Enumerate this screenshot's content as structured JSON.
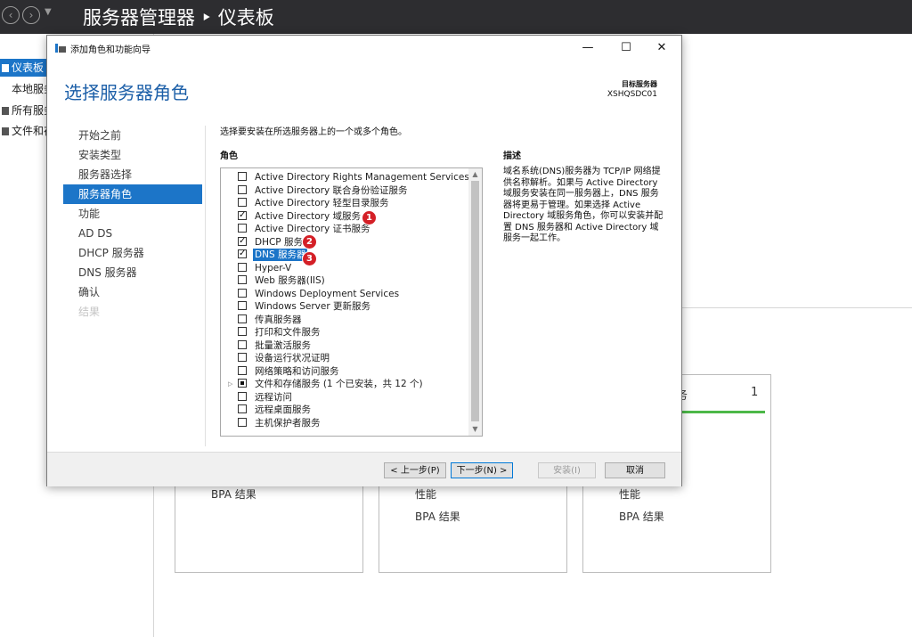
{
  "server_manager": {
    "title": "服务器管理器 ‣ 仪表板",
    "nav": [
      {
        "label": "仪表板",
        "active": true
      },
      {
        "label": "本地服务",
        "active": false
      },
      {
        "label": "所有服务",
        "active": false
      },
      {
        "label": "文件和存",
        "active": false
      }
    ],
    "tiles": [
      {
        "lines": [
          "BPA 结果"
        ]
      },
      {
        "lines": [
          "性能",
          "BPA 结果"
        ]
      },
      {
        "lines": [
          "性能",
          "BPA 结果"
        ],
        "header_fragment": "务",
        "count": "1"
      }
    ],
    "accent_color": "#1c75c8",
    "status_color": "#4cb848"
  },
  "wizard": {
    "title": "添加角色和功能向导",
    "controls": {
      "minimize": "—",
      "maximize": "☐",
      "close": "✕"
    },
    "heading": "选择服务器角色",
    "target_label": "目标服务器",
    "target_server": "XSHQSDC01",
    "steps": [
      {
        "label": "开始之前",
        "state": "normal"
      },
      {
        "label": "安装类型",
        "state": "normal"
      },
      {
        "label": "服务器选择",
        "state": "normal"
      },
      {
        "label": "服务器角色",
        "state": "active"
      },
      {
        "label": "功能",
        "state": "normal"
      },
      {
        "label": "AD DS",
        "state": "normal"
      },
      {
        "label": "DHCP 服务器",
        "state": "normal"
      },
      {
        "label": "DNS 服务器",
        "state": "normal"
      },
      {
        "label": "确认",
        "state": "normal"
      },
      {
        "label": "结果",
        "state": "disabled"
      }
    ],
    "instruction": "选择要安装在所选服务器上的一个或多个角色。",
    "roles_label": "角色",
    "description_label": "描述",
    "roles": [
      {
        "label": "Active Directory Rights Management Services",
        "checked": false
      },
      {
        "label": "Active Directory 联合身份验证服务",
        "checked": false
      },
      {
        "label": "Active Directory 轻型目录服务",
        "checked": false
      },
      {
        "label": "Active Directory 域服务",
        "checked": true,
        "badge": "1"
      },
      {
        "label": "Active Directory 证书服务",
        "checked": false
      },
      {
        "label": "DHCP 服务器",
        "checked": true,
        "badge": "2"
      },
      {
        "label": "DNS 服务器",
        "checked": true,
        "selected": true,
        "badge": "3"
      },
      {
        "label": "Hyper-V",
        "checked": false
      },
      {
        "label": "Web 服务器(IIS)",
        "checked": false
      },
      {
        "label": "Windows Deployment Services",
        "checked": false
      },
      {
        "label": "Windows Server 更新服务",
        "checked": false
      },
      {
        "label": "传真服务器",
        "checked": false
      },
      {
        "label": "打印和文件服务",
        "checked": false
      },
      {
        "label": "批量激活服务",
        "checked": false
      },
      {
        "label": "设备运行状况证明",
        "checked": false
      },
      {
        "label": "网络策略和访问服务",
        "checked": false
      },
      {
        "label": "文件和存储服务 (1 个已安装，共 12 个)",
        "checked": "partial",
        "expandable": true
      },
      {
        "label": "远程访问",
        "checked": false
      },
      {
        "label": "远程桌面服务",
        "checked": false
      },
      {
        "label": "主机保护者服务",
        "checked": false
      }
    ],
    "description": "域名系统(DNS)服务器为 TCP/IP 网络提供名称解析。如果与 Active Directory 域服务安装在同一服务器上，DNS 服务器将更易于管理。如果选择 Active Directory 域服务角色，你可以安装并配置 DNS 服务器和 Active Directory 域服务一起工作。",
    "buttons": {
      "prev": "< 上一步(P)",
      "next": "下一步(N) >",
      "install": "安装(I)",
      "cancel": "取消"
    },
    "badge_color": "#d42027"
  }
}
